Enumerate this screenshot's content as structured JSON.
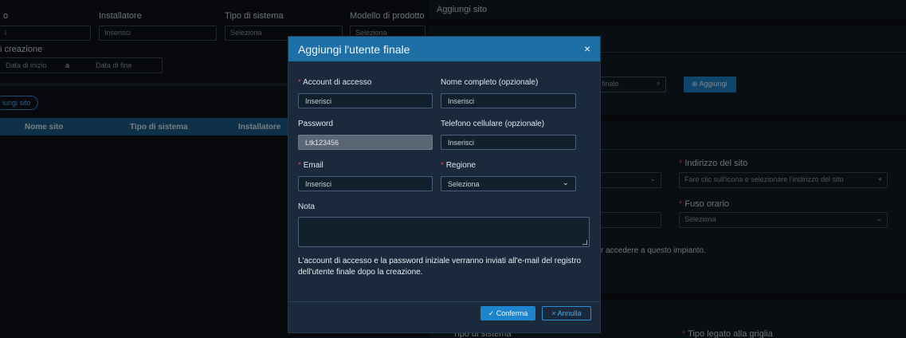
{
  "left": {
    "row1_labels": [
      "o",
      "Installatore",
      "Tipo di sistema",
      "Modello di prodotto"
    ],
    "row1_fields": [
      "i",
      "Inserisci",
      "Seleziona",
      "Seleziona"
    ],
    "creation_label": "i creazione",
    "start_date": "Data di inizio",
    "date_sep": "a",
    "end_date": "Data di fine",
    "add_site_button": "iungi sito",
    "table_headers": [
      "Nome sito",
      "Tipo di sistema",
      "Installatore"
    ]
  },
  "right": {
    "title": "Aggiungi sito",
    "search_placeholder": "te finale",
    "add_button": "⊕ Aggiungi",
    "site_address_label": "Indirizzo del sito",
    "site_address_placeholder": "Fare clic sull'icona e selezionare l'indirizzo del sito",
    "timezone_label": "Fuso orario",
    "timezone_value": "Seleziona",
    "access_text": "r accedere a questo impianto.",
    "system_type_label": "Tipo di sistema",
    "grid_type_label": "Tipo legato alla griglia"
  },
  "modal": {
    "title": "Aggiungi l'utente finale",
    "close_glyph": "×",
    "access_account_label": "Account di accesso",
    "access_account_placeholder": "Inserisci",
    "full_name_label": "Nome completo (opzionale)",
    "full_name_placeholder": "Inserisci",
    "password_label": "Password",
    "password_value": "Ltk123456",
    "phone_label": "Telefono cellulare (opzionale)",
    "phone_placeholder": "Inserisci",
    "email_label": "Email",
    "email_placeholder": "Inserisci",
    "region_label": "Regione",
    "region_value": "Seleziona",
    "note_label": "Nota",
    "note_value": "",
    "info_text": "L'account di accesso e la password iniziale verranno inviati all'e-mail del registro dell'utente finale dopo la creazione.",
    "confirm_button": "✓ Conferma",
    "cancel_button": "× Annulla",
    "required_mark": "*"
  },
  "colors": {
    "modal_header": "#1d6fa5",
    "modal_body": "#1a2a3c",
    "primary": "#1e84cc",
    "required": "#d9443a"
  }
}
